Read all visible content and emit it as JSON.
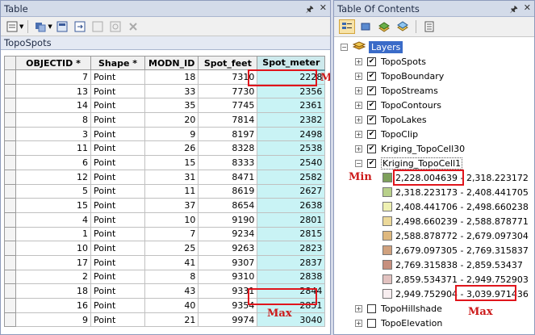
{
  "table_window": {
    "title": "Table",
    "layer_tab": "TopoSpots"
  },
  "columns": [
    "OBJECTID *",
    "Shape *",
    "MODN_ID",
    "Spot_feet",
    "Spot_meter"
  ],
  "rows": [
    [
      "7",
      "Point",
      "18",
      "7310",
      "2228"
    ],
    [
      "13",
      "Point",
      "33",
      "7730",
      "2356"
    ],
    [
      "14",
      "Point",
      "35",
      "7745",
      "2361"
    ],
    [
      "8",
      "Point",
      "20",
      "7814",
      "2382"
    ],
    [
      "3",
      "Point",
      "9",
      "8197",
      "2498"
    ],
    [
      "11",
      "Point",
      "26",
      "8328",
      "2538"
    ],
    [
      "6",
      "Point",
      "15",
      "8333",
      "2540"
    ],
    [
      "12",
      "Point",
      "31",
      "8471",
      "2582"
    ],
    [
      "5",
      "Point",
      "11",
      "8619",
      "2627"
    ],
    [
      "15",
      "Point",
      "37",
      "8654",
      "2638"
    ],
    [
      "4",
      "Point",
      "10",
      "9190",
      "2801"
    ],
    [
      "1",
      "Point",
      "7",
      "9234",
      "2815"
    ],
    [
      "10",
      "Point",
      "25",
      "9263",
      "2823"
    ],
    [
      "17",
      "Point",
      "41",
      "9307",
      "2837"
    ],
    [
      "2",
      "Point",
      "8",
      "9310",
      "2838"
    ],
    [
      "18",
      "Point",
      "43",
      "9331",
      "2844"
    ],
    [
      "16",
      "Point",
      "40",
      "9354",
      "2851"
    ],
    [
      "9",
      "Point",
      "21",
      "9974",
      "3040"
    ]
  ],
  "annotations": {
    "min": "Min",
    "max": "Max"
  },
  "toc": {
    "title": "Table Of Contents",
    "root": "Layers",
    "layers_top": [
      "TopoSpots",
      "TopoBoundary",
      "TopoStreams",
      "TopoContours",
      "TopoLakes",
      "TopoClip",
      "Kriging_TopoCell30",
      "Kriging_TopoCell1"
    ],
    "legend": [
      {
        "label": "2,228.004639 - 2,318.223172",
        "color": "#7ea05c"
      },
      {
        "label": "2,318.223173 - 2,408.441705",
        "color": "#b8d08a"
      },
      {
        "label": "2,408.441706 - 2,498.660238",
        "color": "#eef0b2"
      },
      {
        "label": "2,498.660239 - 2,588.878771",
        "color": "#ecd99a"
      },
      {
        "label": "2,588.878772 - 2,679.097304",
        "color": "#deb87e"
      },
      {
        "label": "2,679.097305 - 2,769.315837",
        "color": "#d0a17e"
      },
      {
        "label": "2,769.315838 - 2,859.53437",
        "color": "#c68f7e"
      },
      {
        "label": "2,859.534371 - 2,949.752903",
        "color": "#e2c2c0"
      },
      {
        "label": "2,949.752904 - 3,039.971436",
        "color": "#f8eef0"
      }
    ],
    "legend_min_value": "2,228.004639",
    "legend_max_value": "3,039.971436",
    "layers_bottom": [
      "TopoHillshade",
      "TopoElevation"
    ]
  }
}
